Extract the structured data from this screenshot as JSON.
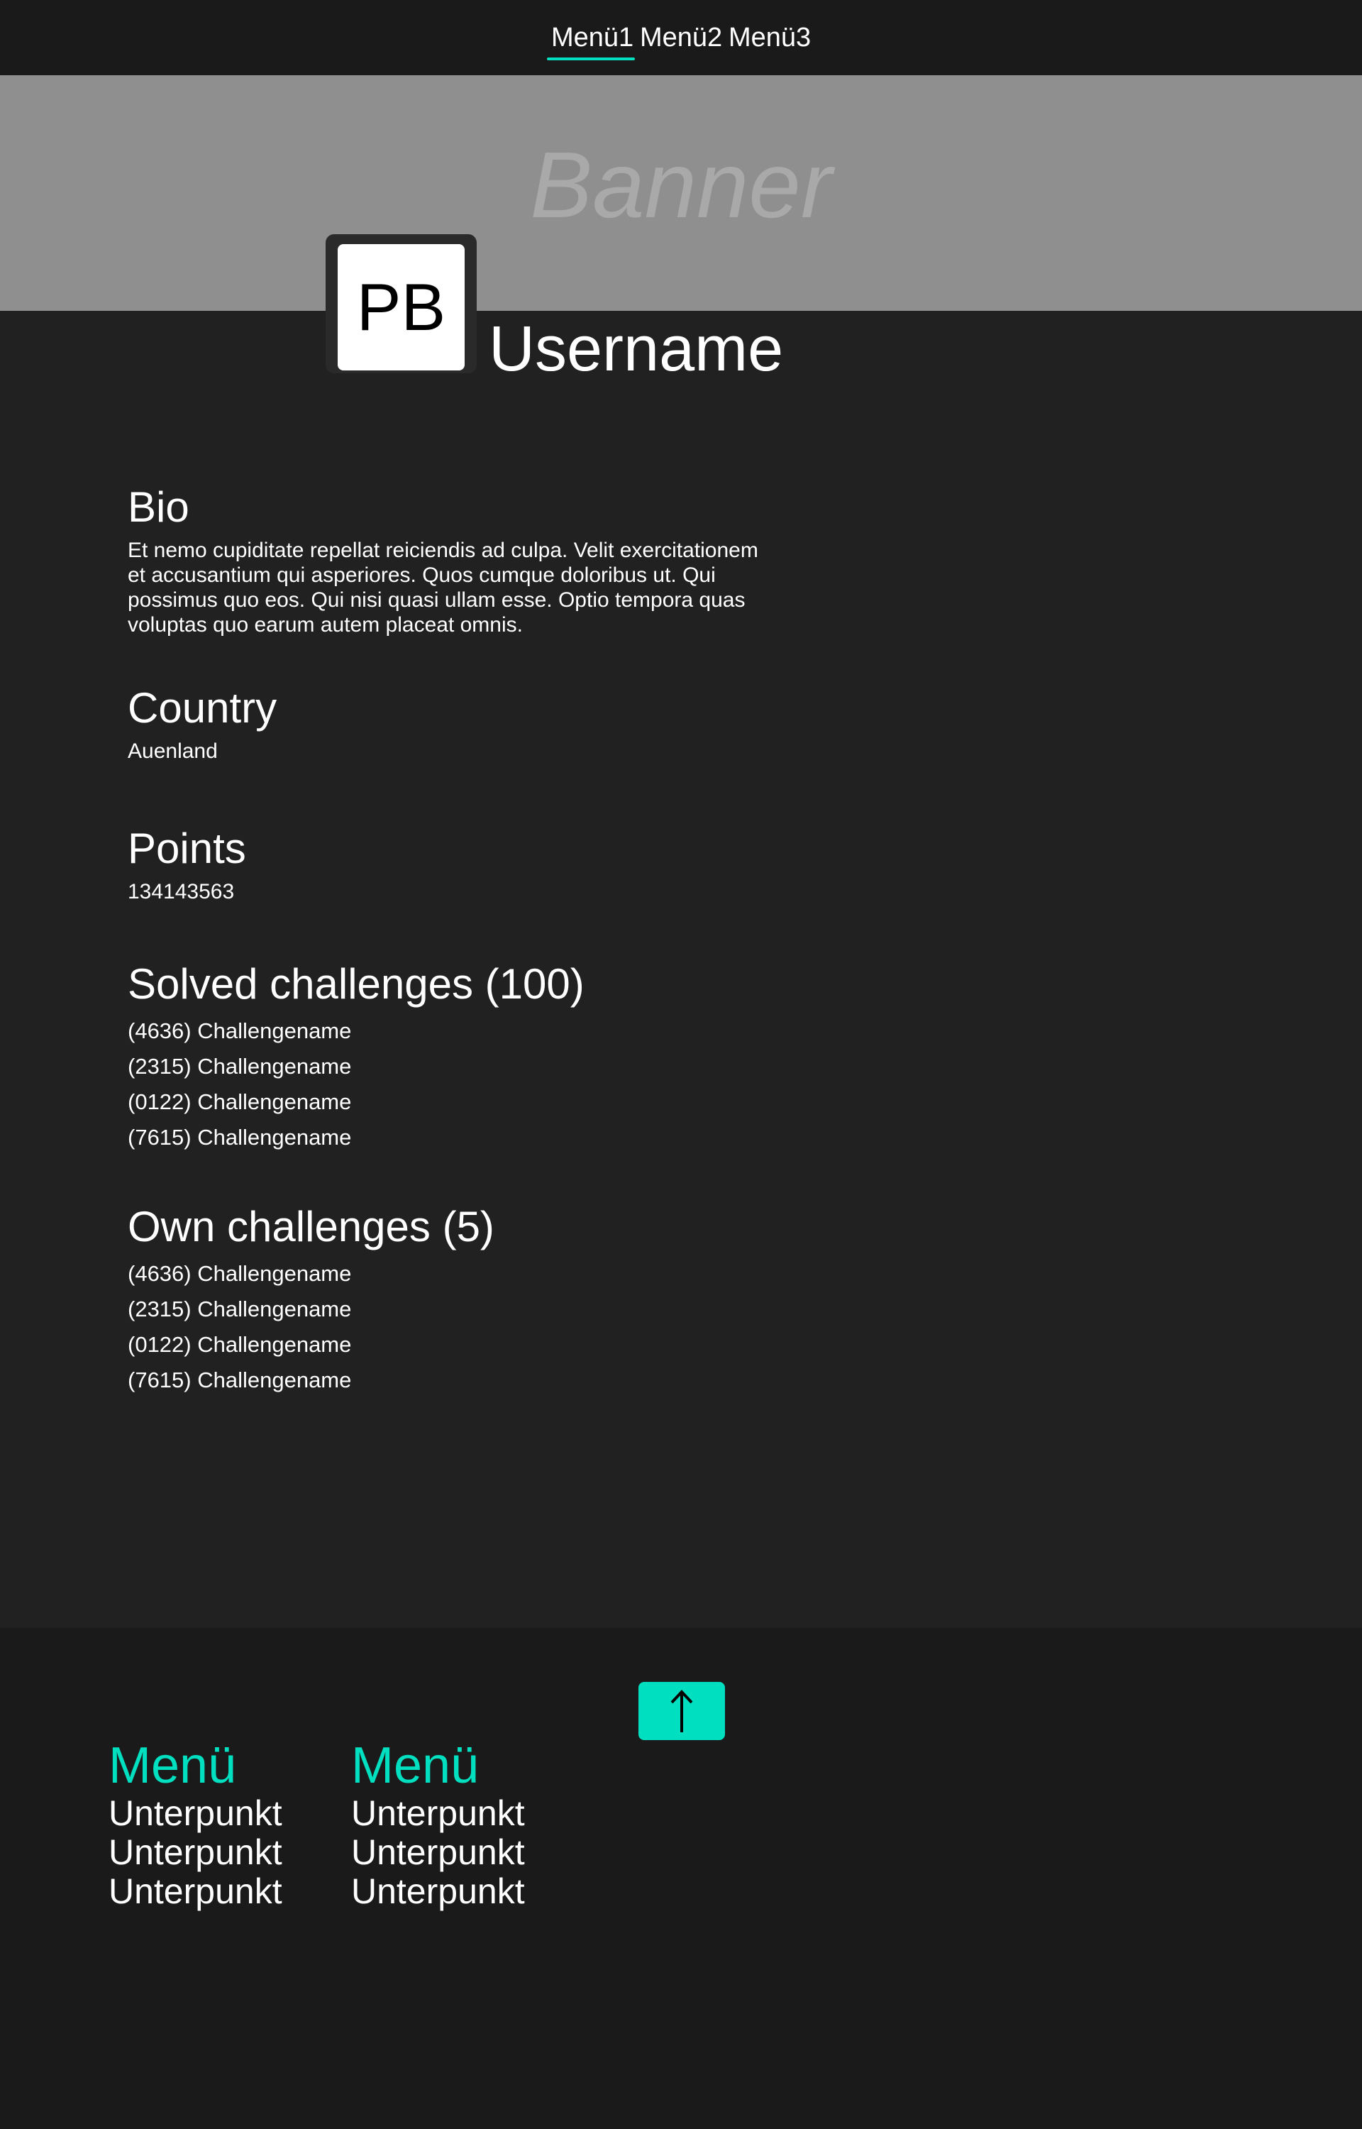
{
  "nav": {
    "items": [
      {
        "label": "Menü1"
      },
      {
        "label": "Menü2"
      },
      {
        "label": "Menü3"
      }
    ],
    "active": "Menü1",
    "accent": "#00dfbf"
  },
  "banner": {
    "text": "Banner"
  },
  "profile": {
    "avatar_initials": "PB",
    "username": "Username"
  },
  "bio": {
    "heading": "Bio",
    "text": "Et nemo cupiditate repellat reiciendis ad culpa. Velit exercitationem et accusantium qui asperiores. Quos cumque doloribus ut. Qui possimus quo eos. Qui nisi quasi ullam esse. Optio tempora quas voluptas quo earum autem placeat omnis."
  },
  "country": {
    "heading": "Country",
    "value": "Auenland"
  },
  "points": {
    "heading": "Points",
    "value": "134143563"
  },
  "solved": {
    "heading": "Solved challenges (100)",
    "items": [
      "(4636) Challengename",
      "(2315) Challengename",
      "(0122) Challengename",
      "(7615) Challengename"
    ]
  },
  "own": {
    "heading": "Own challenges (5)",
    "items": [
      "(4636) Challengename",
      "(2315) Challengename",
      "(0122) Challengename",
      "(7615) Challengename"
    ]
  },
  "footer": {
    "to_top_icon": "arrow-up-icon",
    "columns": [
      {
        "title": "Menü",
        "items": [
          "Unterpunkt",
          "Unterpunkt",
          "Unterpunkt"
        ]
      },
      {
        "title": "Menü",
        "items": [
          "Unterpunkt",
          "Unterpunkt",
          "Unterpunkt"
        ]
      }
    ]
  }
}
